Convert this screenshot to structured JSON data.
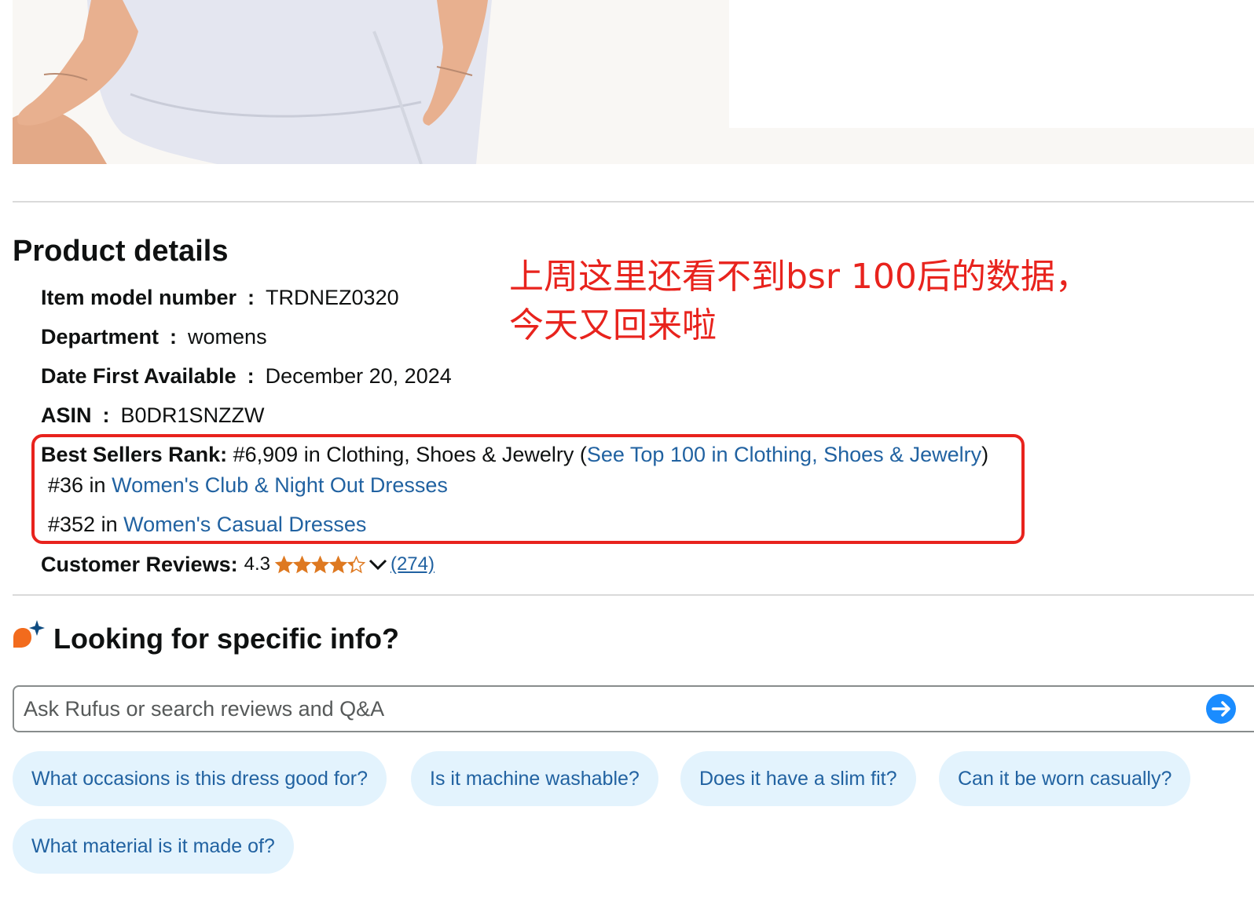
{
  "product_image": {
    "alt": "product-photo"
  },
  "annotation": {
    "line1": "上周这里还看不到bsr 100后的数据，",
    "line2": "今天又回来啦",
    "color": "#e8231d"
  },
  "product_details": {
    "title": "Product details",
    "rows": [
      {
        "label": "Item model number",
        "sep": ":",
        "value": "TRDNEZ0320"
      },
      {
        "label": "Department",
        "sep": ":",
        "value": "womens"
      },
      {
        "label": "Date First Available",
        "sep": ":",
        "value": "December 20, 2024"
      },
      {
        "label": "ASIN",
        "sep": ":",
        "value": "B0DR1SNZZW"
      }
    ],
    "best_sellers_rank": {
      "label": "Best Sellers Rank:",
      "main_rank": " #6,909 in Clothing, Shoes & Jewelry (",
      "main_link": "See Top 100 in Clothing, Shoes & Jewelry",
      "main_close": ")",
      "sub_ranks": [
        {
          "rank": "#36 in ",
          "category": "Women's Club & Night Out Dresses"
        },
        {
          "rank": "#352 in ",
          "category": "Women's Casual Dresses"
        }
      ]
    },
    "customer_reviews": {
      "label": "Customer Reviews:",
      "rating": "4.3",
      "rating_value": 4.3,
      "count": "(274)",
      "star_color": "#de7921"
    }
  },
  "rufus": {
    "title": "Looking for specific info?",
    "search_placeholder": "Ask Rufus or search reviews and Q&A",
    "search_value": "",
    "suggestions": [
      "What occasions is this dress good for?",
      "Is it machine washable?",
      "Does it have a slim fit?",
      "Can it be worn casually?",
      "What material is it made of?"
    ],
    "icon_colors": {
      "blob": "#f26b1d",
      "sparkle": "#0f4c81",
      "go_button": "#1a8cff",
      "link": "#2162a1",
      "chip_bg": "#e3f3fd"
    }
  }
}
